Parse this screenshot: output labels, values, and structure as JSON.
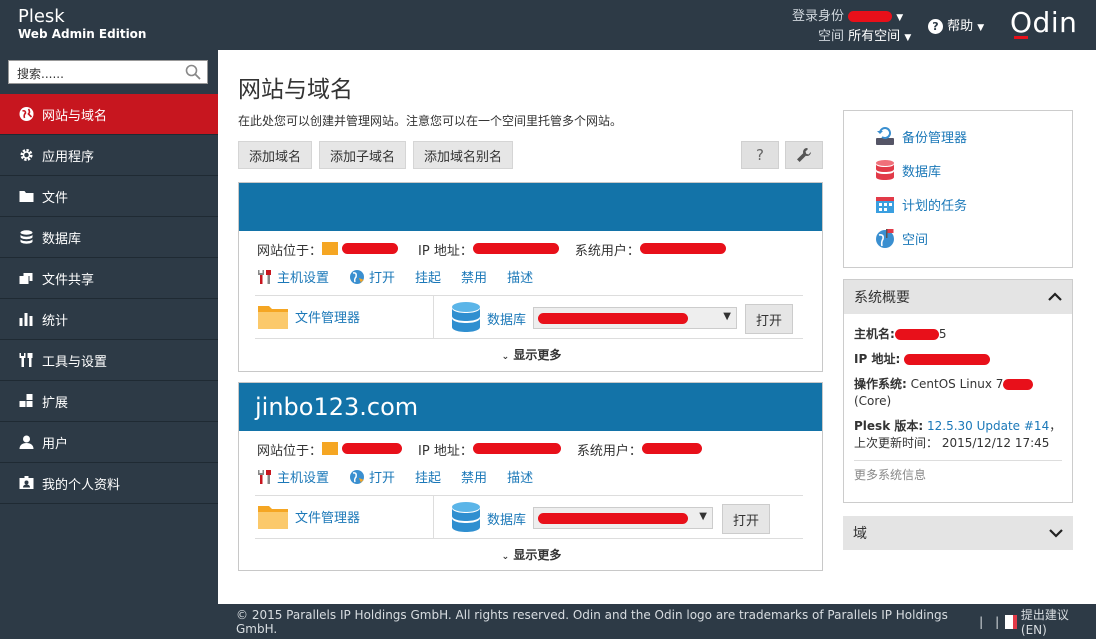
{
  "brand": {
    "line1": "Plesk",
    "line2": "Web Admin Edition",
    "odin": "Odin"
  },
  "topbar": {
    "login_label": "登录身份",
    "space_label": "空间",
    "space_value": "所有空间",
    "help_label": "帮助"
  },
  "sidebar": {
    "search_placeholder": "搜索......",
    "items": [
      {
        "label": "网站与域名",
        "icon": "globe-icon",
        "active": true
      },
      {
        "label": "应用程序",
        "icon": "gear-icon",
        "active": false
      },
      {
        "label": "文件",
        "icon": "folder-icon",
        "active": false
      },
      {
        "label": "数据库",
        "icon": "database-icon",
        "active": false
      },
      {
        "label": "文件共享",
        "icon": "share-icon",
        "active": false
      },
      {
        "label": "统计",
        "icon": "bar-chart-icon",
        "active": false
      },
      {
        "label": "工具与设置",
        "icon": "tools-icon",
        "active": false
      },
      {
        "label": "扩展",
        "icon": "puzzle-icon",
        "active": false
      },
      {
        "label": "用户",
        "icon": "user-icon",
        "active": false
      },
      {
        "label": "我的个人资料",
        "icon": "profile-card-icon",
        "active": false
      }
    ]
  },
  "main": {
    "title": "网站与域名",
    "intro": "在此处您可以创建并管理网站。注意您可以在一个空间里托管多个网站。",
    "buttons": [
      "添加域名",
      "添加子域名",
      "添加域名别名"
    ],
    "help_btn": "?"
  },
  "domains": [
    {
      "name": "",
      "site_at": "网站位于：",
      "ip_label": "IP 地址：",
      "sysuser_label": "系统用户：",
      "actions": [
        "主机设置",
        "打开",
        "挂起",
        "禁用",
        "描述"
      ],
      "file_manager": "文件管理器",
      "db_label": "数据库",
      "open_btn": "打开",
      "more": "显示更多"
    },
    {
      "name": "jinbo123.com",
      "site_at": "网站位于：",
      "ip_label": "IP 地址：",
      "sysuser_label": "系统用户：",
      "actions": [
        "主机设置",
        "打开",
        "挂起",
        "禁用",
        "描述"
      ],
      "file_manager": "文件管理器",
      "db_label": "数据库",
      "open_btn": "打开",
      "more": "显示更多"
    }
  ],
  "right": {
    "links": [
      "备份管理器",
      "数据库",
      "计划的任务",
      "空间"
    ],
    "system": {
      "title": "系统概要",
      "host_label": "主机名:",
      "host_suffix": "5",
      "ip_label": "IP 地址:",
      "os_label": "操作系统:",
      "os_value": "CentOS Linux 7",
      "os_tail": "(Core)",
      "plesk_label": "Plesk 版本:",
      "plesk_value": "12.5.30 Update #14",
      "update_label": "，上次更新时间：",
      "update_value": "2015/12/12 17:45",
      "more": "更多系统信息"
    },
    "domain_box": "域"
  },
  "footer": {
    "text": "© 2015 Parallels IP Holdings GmbH. All rights reserved. Odin and the Odin logo are trademarks of Parallels IP Holdings GmbH.",
    "sep": "|",
    "feedback": "提出建议 (EN)"
  }
}
